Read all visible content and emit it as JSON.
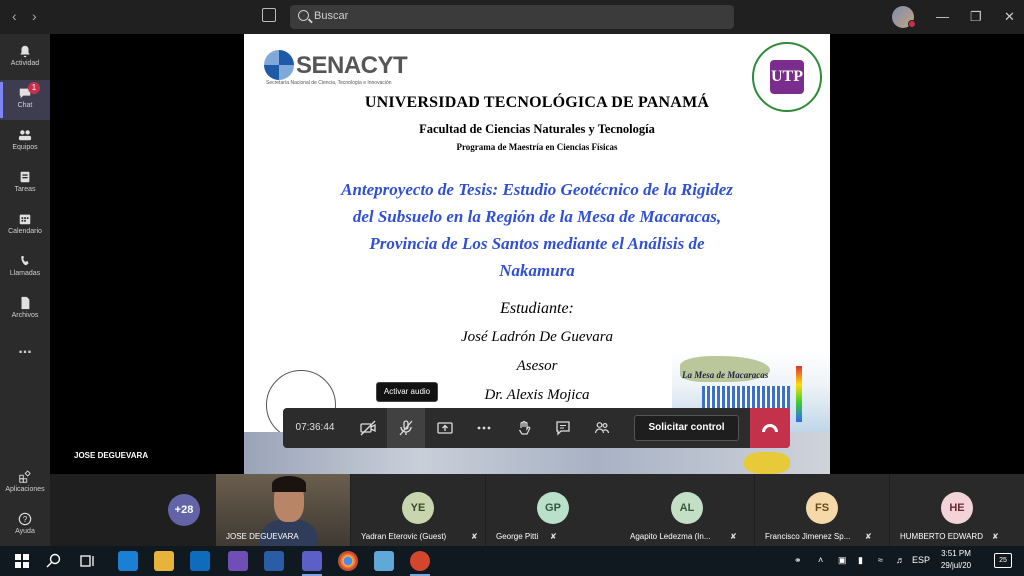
{
  "search": {
    "placeholder": "Buscar"
  },
  "rail": {
    "items": [
      {
        "label": "Actividad"
      },
      {
        "label": "Chat",
        "badge": "1"
      },
      {
        "label": "Equipos"
      },
      {
        "label": "Tareas"
      },
      {
        "label": "Calendario"
      },
      {
        "label": "Llamadas"
      },
      {
        "label": "Archivos"
      },
      {
        "label": "..."
      },
      {
        "label": "Aplicaciones"
      },
      {
        "label": "Ayuda"
      }
    ]
  },
  "slide": {
    "senacyt_name": "SENACYT",
    "senacyt_sub": "Secretaría Nacional de Ciencia, Tecnología e Innovación",
    "utp_seal": "UTP",
    "university": "UNIVERSIDAD TECNOLÓGICA DE PANAMÁ",
    "faculty": "Facultad de Ciencias Naturales y Tecnología",
    "program": "Programa de Maestría en Ciencias Físicas",
    "thesis_lines": [
      "Anteproyecto de Tesis: Estudio Geotécnico de la Rigidez",
      "del Subsuelo en la Región de la Mesa de Macaracas,",
      "Provincia de Los Santos mediante el Análisis de",
      "Nakamura"
    ],
    "student_label": "Estudiante:",
    "student": "José Ladrón De Guevara",
    "advisor_label": "Asesor",
    "advisor": "Dr. Alexis Mojica",
    "map_caption": "La Mesa de Macaracas"
  },
  "presenter": {
    "name": "JOSE DEGUEVARA"
  },
  "controls": {
    "tooltip": "Activar audio",
    "timer": "07:36:44",
    "request_control": "Solicitar control"
  },
  "participants": {
    "overflow": "+28",
    "list": [
      {
        "initials": "",
        "name": "JOSE DEGUEVARA",
        "video": true
      },
      {
        "initials": "YE",
        "name": "Yadran Eterovic (Guest)",
        "color": "#c8d6b0",
        "fg": "#3b4a2a"
      },
      {
        "initials": "GP",
        "name": "George Pitti",
        "color": "#b9e0c8",
        "fg": "#2e5a3f"
      },
      {
        "initials": "AL",
        "name": "Agapito Ledezma (In...",
        "color": "#c3dfc6",
        "fg": "#3a5a3c"
      },
      {
        "initials": "FS",
        "name": "Francisco Jimenez Sp...",
        "color": "#f5d9a8",
        "fg": "#6a4a1a"
      },
      {
        "initials": "HE",
        "name": "HUMBERTO EDWARD",
        "color": "#f2d4d8",
        "fg": "#6a2b35"
      }
    ]
  },
  "taskbar": {
    "time": "3:51 PM",
    "date": "29/jul/20",
    "lang": "ESP",
    "notifications": "25"
  }
}
